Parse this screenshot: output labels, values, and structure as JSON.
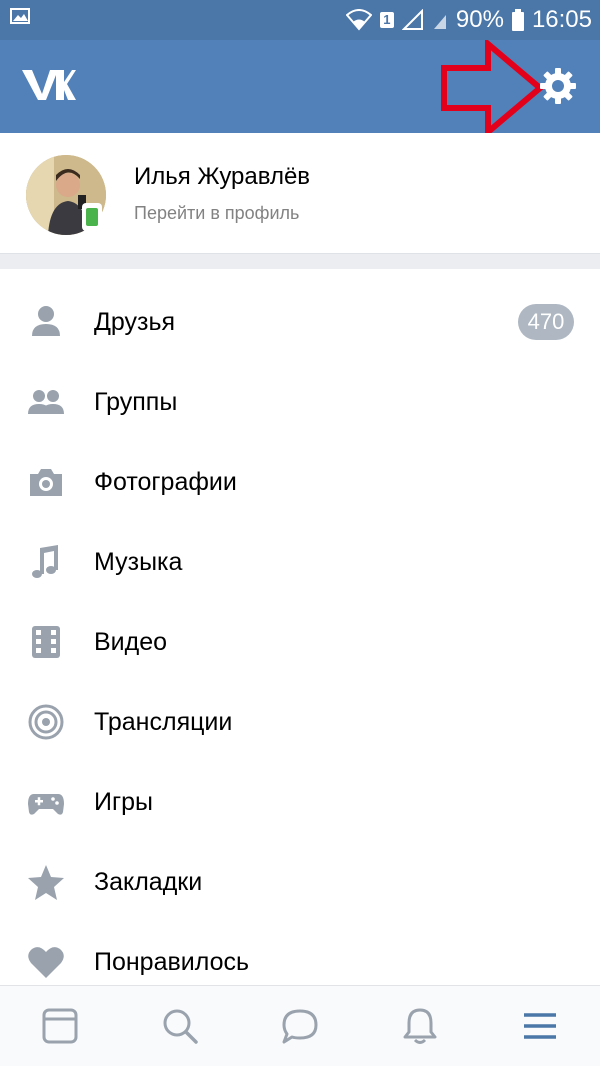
{
  "status_bar": {
    "sim_label": "1",
    "battery_percent": "90%",
    "time": "16:05"
  },
  "app": {
    "name_icon": "vk-logo-icon"
  },
  "profile": {
    "name": "Илья Журавлёв",
    "subtitle": "Перейти в профиль"
  },
  "menu": {
    "items": [
      {
        "label": "Друзья",
        "icon": "person-icon",
        "badge": "470"
      },
      {
        "label": "Группы",
        "icon": "people-icon"
      },
      {
        "label": "Фотографии",
        "icon": "camera-icon"
      },
      {
        "label": "Музыка",
        "icon": "music-note-icon"
      },
      {
        "label": "Видео",
        "icon": "film-icon"
      },
      {
        "label": "Трансляции",
        "icon": "broadcast-icon"
      },
      {
        "label": "Игры",
        "icon": "gamepad-icon"
      },
      {
        "label": "Закладки",
        "icon": "star-icon"
      },
      {
        "label": "Понравилось",
        "icon": "heart-icon"
      }
    ]
  },
  "bottom_nav": {
    "tabs": [
      "news-icon",
      "search-icon",
      "messages-icon",
      "notifications-icon",
      "menu-icon"
    ],
    "active": "menu-icon"
  },
  "colors": {
    "header": "#5181b8",
    "status_bar": "#4a76a8",
    "icon_gray": "#99a2ad",
    "active_tab": "#4a76a8",
    "badge": "#aeb7c2",
    "annotation_red": "#e3001b"
  }
}
